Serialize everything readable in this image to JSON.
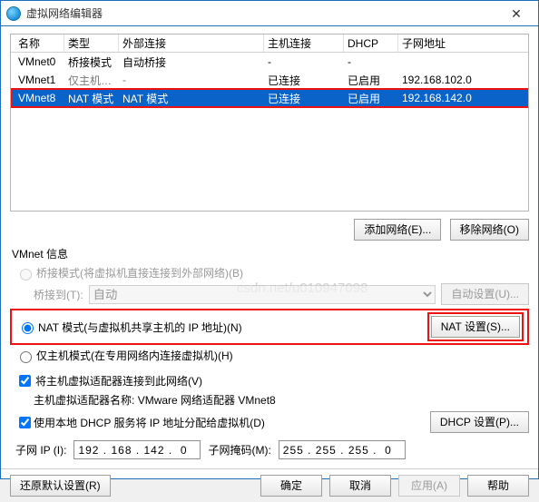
{
  "window": {
    "title": "虚拟网络编辑器",
    "close_glyph": "✕"
  },
  "table": {
    "headers": {
      "name": "名称",
      "type": "类型",
      "ext": "外部连接",
      "host": "主机连接",
      "dhcp": "DHCP",
      "subnet": "子网地址"
    },
    "rows": [
      {
        "name": "VMnet0",
        "type": "桥接模式",
        "ext": "自动桥接",
        "host": "-",
        "dhcp": "-",
        "subnet": ""
      },
      {
        "name": "VMnet1",
        "type": "仅主机…",
        "ext": "-",
        "host": "已连接",
        "dhcp": "已启用",
        "subnet": "192.168.102.0"
      },
      {
        "name": "VMnet8",
        "type": "NAT 模式",
        "ext": "NAT 模式",
        "host": "已连接",
        "dhcp": "已启用",
        "subnet": "192.168.142.0"
      }
    ]
  },
  "buttons": {
    "add_net": "添加网络(E)...",
    "remove_net": "移除网络(O)",
    "auto_set": "自动设置(U)...",
    "nat_set": "NAT 设置(S)...",
    "dhcp_set": "DHCP 设置(P)...",
    "restore_defaults": "还原默认设置(R)",
    "ok": "确定",
    "cancel": "取消",
    "apply": "应用(A)",
    "help": "帮助"
  },
  "vmnet_info": {
    "title": "VMnet 信息",
    "bridge_radio": "桥接模式(将虚拟机直接连接到外部网络)(B)",
    "bridge_to_label": "桥接到(T):",
    "bridge_to_value": "自动",
    "nat_radio": "NAT 模式(与虚拟机共享主机的 IP 地址)(N)",
    "hostonly_radio": "仅主机模式(在专用网络内连接虚拟机)(H)",
    "host_adapter_check": "将主机虚拟适配器连接到此网络(V)",
    "host_adapter_name_label": "主机虚拟适配器名称:",
    "host_adapter_name_value": "VMware 网络适配器 VMnet8",
    "dhcp_check": "使用本地 DHCP 服务将 IP 地址分配给虚拟机(D)",
    "subnet_ip_label": "子网 IP (I):",
    "subnet_ip_value": "192 . 168 . 142 .  0",
    "subnet_mask_label": "子网掩码(M):",
    "subnet_mask_value": "255 . 255 . 255 .  0"
  },
  "watermark": "csdn.net/u010947098"
}
